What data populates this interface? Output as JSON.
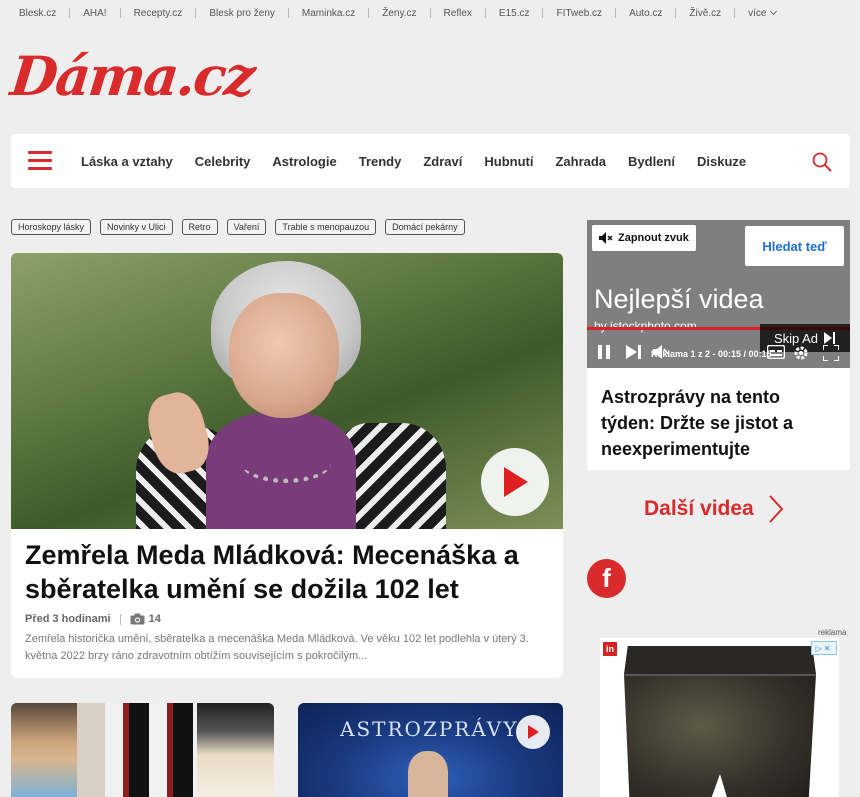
{
  "topbar": {
    "links": [
      "Blesk.cz",
      "AHA!",
      "Recepty.cz",
      "Blesk pro ženy",
      "Maminka.cz",
      "Ženy.cz",
      "Reflex",
      "E15.cz",
      "FITweb.cz",
      "Auto.cz",
      "Živě.cz"
    ],
    "more_label": "více"
  },
  "logo": {
    "text": "Dáma.cz"
  },
  "nav": {
    "items": [
      "Láska a vztahy",
      "Celebrity",
      "Astrologie",
      "Trendy",
      "Zdraví",
      "Hubnutí",
      "Zahrada",
      "Bydlení",
      "Diskuze"
    ]
  },
  "tags": [
    "Horoskopy lásky",
    "Novinky v Ulici",
    "Retro",
    "Vaření",
    "Trable s menopauzou",
    "Domácí pekárny"
  ],
  "hero": {
    "title": "Zemřela Meda Mládková: Mecenáška a sběratelka umění se dožila 102 let",
    "time": "Před 3 hodinami",
    "photo_count": "14",
    "perex": "Zemřela historička umění, sběratelka a mecenáška Meda Mládková. Ve věku 102 let podlehla v úterý 3. května 2022 brzy ráno zdravotním obtížím souvisejícím s pokročilým..."
  },
  "thumb2": {
    "label": "ASTROZPRÁVY"
  },
  "video": {
    "mute_label": "Zapnout zvuk",
    "cta_label": "Hledat teď",
    "headline": "Nejlepší videa",
    "source": "by istockphoto.com",
    "skip_label": "Skip Ad",
    "time_label": "Reklama 1 z 2 - 00:15 / 00:15",
    "progress": 1.0
  },
  "side": {
    "title": "Astrozprávy na tento týden: Držte se jistot a neexperimentujte",
    "more_videos": "Další videa",
    "ad_label": "reklama"
  },
  "colors": {
    "brand": "#d92b2b",
    "link_blue": "#1e6fd1"
  }
}
